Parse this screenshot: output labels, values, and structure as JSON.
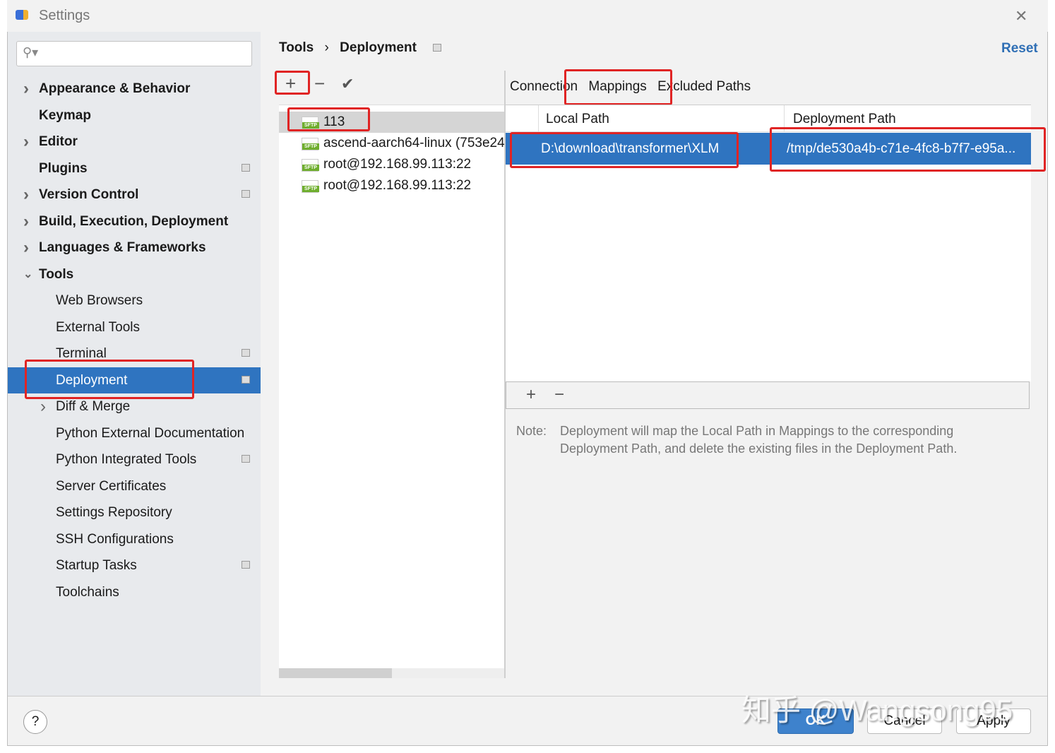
{
  "window": {
    "title": "Settings",
    "close": "✕"
  },
  "search": {
    "placeholder": ""
  },
  "sidebar": {
    "items": [
      {
        "label": "Appearance & Behavior",
        "bold": true,
        "chevron": "right",
        "pin": false
      },
      {
        "label": "Keymap",
        "bold": true,
        "chevron": "",
        "pin": false
      },
      {
        "label": "Editor",
        "bold": true,
        "chevron": "right",
        "pin": false
      },
      {
        "label": "Plugins",
        "bold": true,
        "chevron": "",
        "pin": true
      },
      {
        "label": "Version Control",
        "bold": true,
        "chevron": "right",
        "pin": true
      },
      {
        "label": "Build, Execution, Deployment",
        "bold": true,
        "chevron": "right",
        "pin": false
      },
      {
        "label": "Languages & Frameworks",
        "bold": true,
        "chevron": "right",
        "pin": false
      },
      {
        "label": "Tools",
        "bold": true,
        "chevron": "down",
        "pin": false
      },
      {
        "label": "Web Browsers",
        "sub": true,
        "pin": false
      },
      {
        "label": "External Tools",
        "sub": true,
        "pin": false
      },
      {
        "label": "Terminal",
        "sub": true,
        "pin": true
      },
      {
        "label": "Deployment",
        "sub": true,
        "pin": true,
        "selected": true
      },
      {
        "label": "Diff & Merge",
        "sub": true,
        "chevron": "right",
        "pin": false
      },
      {
        "label": "Python External Documentation",
        "sub": true,
        "pin": false
      },
      {
        "label": "Python Integrated Tools",
        "sub": true,
        "pin": true
      },
      {
        "label": "Server Certificates",
        "sub": true,
        "pin": false
      },
      {
        "label": "Settings Repository",
        "sub": true,
        "pin": false
      },
      {
        "label": "SSH Configurations",
        "sub": true,
        "pin": false
      },
      {
        "label": "Startup Tasks",
        "sub": true,
        "pin": true
      },
      {
        "label": "Toolchains",
        "sub": true,
        "pin": false
      }
    ]
  },
  "breadcrumb": {
    "parent": "Tools",
    "sep": "›",
    "current": "Deployment"
  },
  "reset_label": "Reset",
  "toolbar": {
    "add": "+",
    "remove": "−",
    "check": "✔"
  },
  "servers": [
    {
      "name": "113",
      "icon": "SFTP",
      "selected": true
    },
    {
      "name": "ascend-aarch64-linux (753e24",
      "icon": "SFTP"
    },
    {
      "name": "root@192.168.99.113:22",
      "icon": "SFTP"
    },
    {
      "name": "root@192.168.99.113:22",
      "icon": "SFTP"
    }
  ],
  "tabs": [
    "Connection",
    "Mappings",
    "Excluded Paths"
  ],
  "active_tab": "Mappings",
  "mappings": {
    "columns": [
      "Local Path",
      "Deployment Path"
    ],
    "rows": [
      [
        "D:\\download\\transformer\\XLM",
        "/tmp/de530a4b-c71e-4fc8-b7f7-e95a..."
      ]
    ],
    "add": "+",
    "remove": "−"
  },
  "note": {
    "label": "Note:",
    "line1": "Deployment will map the Local Path in Mappings to the corresponding",
    "line2": "Deployment Path, and delete the existing files in the Deployment Path."
  },
  "footer": {
    "help": "?",
    "ok": "OK",
    "cancel": "Cancel",
    "apply": "Apply"
  },
  "watermark": "知乎 @Wangsong95",
  "colors": {
    "selection": "#2f74c0",
    "annotation": "#e02424",
    "link": "#2f6fb5"
  }
}
